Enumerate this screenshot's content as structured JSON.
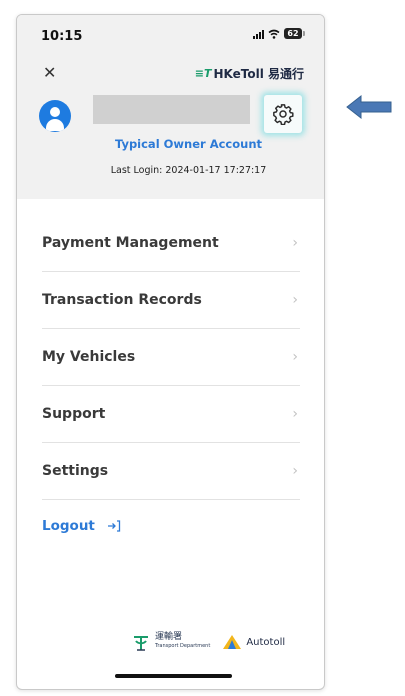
{
  "status_bar": {
    "time": "10:15",
    "battery": "62"
  },
  "header": {
    "close_glyph": "✕",
    "brand_mark": "≡T",
    "brand_name": "HKeToll 易通行"
  },
  "profile": {
    "account_type": "Typical Owner Account",
    "last_login": "Last Login: 2024-01-17 17:27:17",
    "settings_icon": "gear-icon",
    "avatar_icon": "user-avatar-icon"
  },
  "menu": {
    "items": [
      {
        "label": "Payment Management"
      },
      {
        "label": "Transaction Records"
      },
      {
        "label": "My Vehicles"
      },
      {
        "label": "Support"
      },
      {
        "label": "Settings"
      }
    ],
    "chevron": "›",
    "logout_label": "Logout",
    "logout_icon": "logout-icon"
  },
  "footer": {
    "td_cn": "運輸署",
    "td_en": "Transport Department",
    "autotoll": "Autotoll"
  },
  "annotation": {
    "arrow_color": "#4a78b5"
  },
  "colors": {
    "accent": "#2d7ad6",
    "avatar": "#1e7be0",
    "highlight_glow": "#78dce1"
  }
}
